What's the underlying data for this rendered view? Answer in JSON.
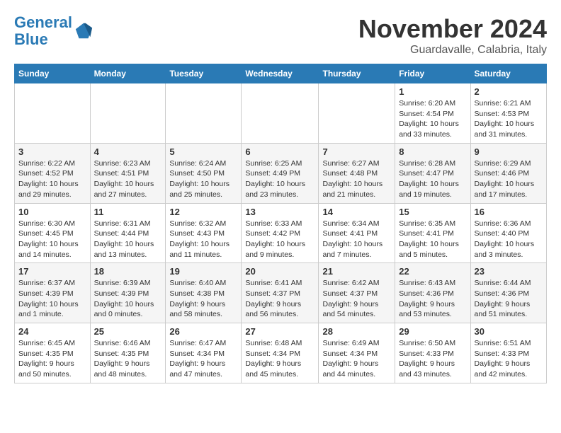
{
  "header": {
    "logo_line1": "General",
    "logo_line2": "Blue",
    "month": "November 2024",
    "location": "Guardavalle, Calabria, Italy"
  },
  "columns": [
    "Sunday",
    "Monday",
    "Tuesday",
    "Wednesday",
    "Thursday",
    "Friday",
    "Saturday"
  ],
  "weeks": [
    [
      {
        "day": "",
        "info": ""
      },
      {
        "day": "",
        "info": ""
      },
      {
        "day": "",
        "info": ""
      },
      {
        "day": "",
        "info": ""
      },
      {
        "day": "",
        "info": ""
      },
      {
        "day": "1",
        "info": "Sunrise: 6:20 AM\nSunset: 4:54 PM\nDaylight: 10 hours and 33 minutes."
      },
      {
        "day": "2",
        "info": "Sunrise: 6:21 AM\nSunset: 4:53 PM\nDaylight: 10 hours and 31 minutes."
      }
    ],
    [
      {
        "day": "3",
        "info": "Sunrise: 6:22 AM\nSunset: 4:52 PM\nDaylight: 10 hours and 29 minutes."
      },
      {
        "day": "4",
        "info": "Sunrise: 6:23 AM\nSunset: 4:51 PM\nDaylight: 10 hours and 27 minutes."
      },
      {
        "day": "5",
        "info": "Sunrise: 6:24 AM\nSunset: 4:50 PM\nDaylight: 10 hours and 25 minutes."
      },
      {
        "day": "6",
        "info": "Sunrise: 6:25 AM\nSunset: 4:49 PM\nDaylight: 10 hours and 23 minutes."
      },
      {
        "day": "7",
        "info": "Sunrise: 6:27 AM\nSunset: 4:48 PM\nDaylight: 10 hours and 21 minutes."
      },
      {
        "day": "8",
        "info": "Sunrise: 6:28 AM\nSunset: 4:47 PM\nDaylight: 10 hours and 19 minutes."
      },
      {
        "day": "9",
        "info": "Sunrise: 6:29 AM\nSunset: 4:46 PM\nDaylight: 10 hours and 17 minutes."
      }
    ],
    [
      {
        "day": "10",
        "info": "Sunrise: 6:30 AM\nSunset: 4:45 PM\nDaylight: 10 hours and 14 minutes."
      },
      {
        "day": "11",
        "info": "Sunrise: 6:31 AM\nSunset: 4:44 PM\nDaylight: 10 hours and 13 minutes."
      },
      {
        "day": "12",
        "info": "Sunrise: 6:32 AM\nSunset: 4:43 PM\nDaylight: 10 hours and 11 minutes."
      },
      {
        "day": "13",
        "info": "Sunrise: 6:33 AM\nSunset: 4:42 PM\nDaylight: 10 hours and 9 minutes."
      },
      {
        "day": "14",
        "info": "Sunrise: 6:34 AM\nSunset: 4:41 PM\nDaylight: 10 hours and 7 minutes."
      },
      {
        "day": "15",
        "info": "Sunrise: 6:35 AM\nSunset: 4:41 PM\nDaylight: 10 hours and 5 minutes."
      },
      {
        "day": "16",
        "info": "Sunrise: 6:36 AM\nSunset: 4:40 PM\nDaylight: 10 hours and 3 minutes."
      }
    ],
    [
      {
        "day": "17",
        "info": "Sunrise: 6:37 AM\nSunset: 4:39 PM\nDaylight: 10 hours and 1 minute."
      },
      {
        "day": "18",
        "info": "Sunrise: 6:39 AM\nSunset: 4:39 PM\nDaylight: 10 hours and 0 minutes."
      },
      {
        "day": "19",
        "info": "Sunrise: 6:40 AM\nSunset: 4:38 PM\nDaylight: 9 hours and 58 minutes."
      },
      {
        "day": "20",
        "info": "Sunrise: 6:41 AM\nSunset: 4:37 PM\nDaylight: 9 hours and 56 minutes."
      },
      {
        "day": "21",
        "info": "Sunrise: 6:42 AM\nSunset: 4:37 PM\nDaylight: 9 hours and 54 minutes."
      },
      {
        "day": "22",
        "info": "Sunrise: 6:43 AM\nSunset: 4:36 PM\nDaylight: 9 hours and 53 minutes."
      },
      {
        "day": "23",
        "info": "Sunrise: 6:44 AM\nSunset: 4:36 PM\nDaylight: 9 hours and 51 minutes."
      }
    ],
    [
      {
        "day": "24",
        "info": "Sunrise: 6:45 AM\nSunset: 4:35 PM\nDaylight: 9 hours and 50 minutes."
      },
      {
        "day": "25",
        "info": "Sunrise: 6:46 AM\nSunset: 4:35 PM\nDaylight: 9 hours and 48 minutes."
      },
      {
        "day": "26",
        "info": "Sunrise: 6:47 AM\nSunset: 4:34 PM\nDaylight: 9 hours and 47 minutes."
      },
      {
        "day": "27",
        "info": "Sunrise: 6:48 AM\nSunset: 4:34 PM\nDaylight: 9 hours and 45 minutes."
      },
      {
        "day": "28",
        "info": "Sunrise: 6:49 AM\nSunset: 4:34 PM\nDaylight: 9 hours and 44 minutes."
      },
      {
        "day": "29",
        "info": "Sunrise: 6:50 AM\nSunset: 4:33 PM\nDaylight: 9 hours and 43 minutes."
      },
      {
        "day": "30",
        "info": "Sunrise: 6:51 AM\nSunset: 4:33 PM\nDaylight: 9 hours and 42 minutes."
      }
    ]
  ]
}
